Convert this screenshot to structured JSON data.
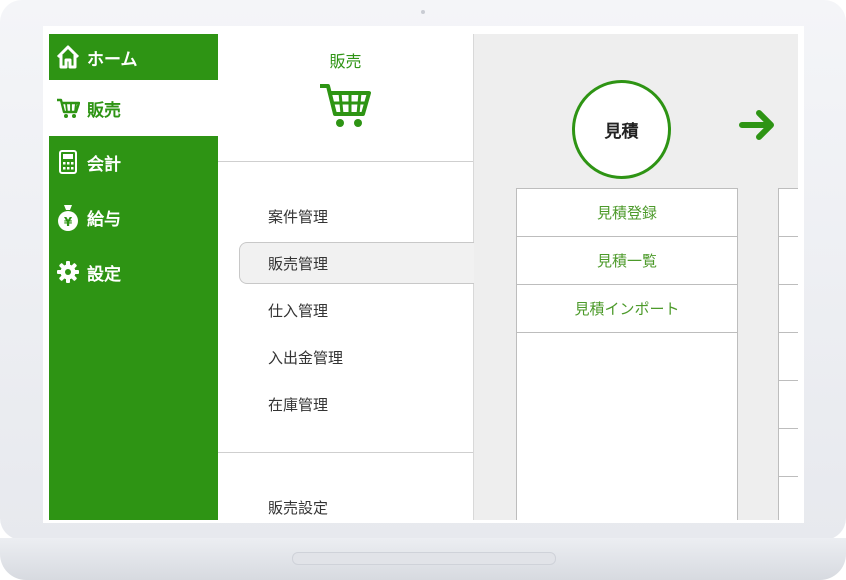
{
  "nav": {
    "items": [
      {
        "label": "ホーム",
        "icon": "home-icon"
      },
      {
        "label": "販売",
        "icon": "cart-icon",
        "active": true
      },
      {
        "label": "会計",
        "icon": "calculator-icon"
      },
      {
        "label": "給与",
        "icon": "money-bag-icon"
      },
      {
        "label": "設定",
        "icon": "gear-icon"
      }
    ]
  },
  "submenu": {
    "title": "販売",
    "items": [
      "案件管理",
      "販売管理",
      "仕入管理",
      "入出金管理",
      "在庫管理"
    ],
    "active_item": "販売管理",
    "settings": "販売設定"
  },
  "content": {
    "step_label": "見積",
    "actions": [
      "見積登録",
      "見積一覧",
      "見積インポート"
    ]
  },
  "colors": {
    "brand_green": "#2e9414",
    "link_green": "#4c9a2a",
    "panel_bg": "#eeeeee"
  }
}
